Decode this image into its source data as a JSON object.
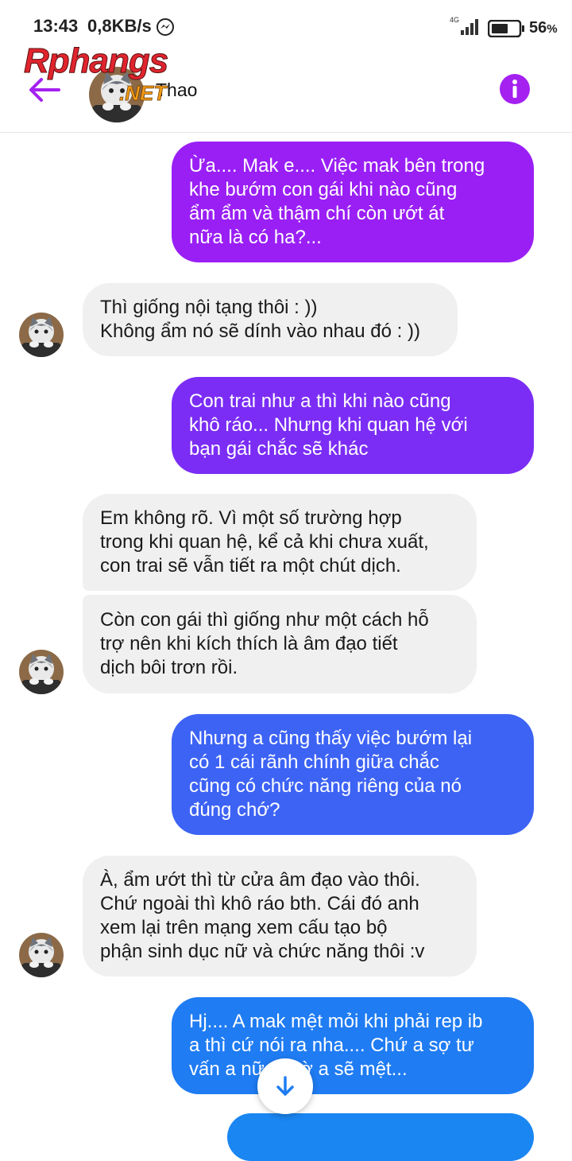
{
  "status_bar": {
    "time": "13:43",
    "speed": "0,8KB/s",
    "network": "4G",
    "battery": "56",
    "battery_unit": "%"
  },
  "header": {
    "contact_name": "Thao",
    "watermark_main": "Rphangs",
    "watermark_sub": ".NET"
  },
  "colors": {
    "accent_purple": "#a421f0",
    "bubble_purple": "#9a1ff5",
    "bubble_violet": "#7b2df5",
    "bubble_blue": "#3d63f5",
    "bubble_lightblue": "#1f7cf3",
    "incoming_bg": "#f0f0f0"
  },
  "messages": [
    {
      "dir": "out",
      "text": "Ừa.... Mak e.... Việc  mak bên trong\nkhe bướm con gái  khi nào  cũng\nẩm ẩm và  thậm chí  còn  ướt át\nnữa  là  có  ha?..."
    },
    {
      "dir": "in",
      "text": "Thì giống nội tạng thôi : ))\nKhông ẩm nó sẽ dính vào nhau đó : ))"
    },
    {
      "dir": "out",
      "text": "Con trai như  a thì  khi nào  cũng\nkhô ráo... Nhưng  khi quan hệ  với\nbạn gái  chắc  sẽ  khác"
    },
    {
      "dir": "in",
      "text": "Em không rõ. Vì một số trường hợp\ntrong khi quan hệ, kể cả khi chưa xuất,\ncon trai sẽ vẫn tiết ra một chút dịch."
    },
    {
      "dir": "in",
      "text": "Còn con gái thì giống như một cách hỗ\ntrợ nên khi kích thích là âm đạo tiết\ndịch bôi trơn rồi."
    },
    {
      "dir": "out",
      "text": "Nhưng  a cũng  thấy  việc  bướm lại\ncó  1 cái  rãnh  chính  giữa  chắc\ncũng  có  chức năng  riêng của  nó\nđúng  chớ?"
    },
    {
      "dir": "in",
      "text": "À, ẩm ướt thì từ cửa âm đạo vào thôi.\nChứ ngoài thì khô ráo bth. Cái đó anh\nxem lại trên mạng xem cấu tạo bộ\nphận sinh dục nữ và chức năng thôi :v"
    },
    {
      "dir": "out",
      "text": "Hj.... A mak mệt mỏi  khi phải rep ib\na thì  cứ  nói  ra nha.... Chứ  a sợ  tư\nvấn  a nữa chờ  a sẽ  mệt..."
    }
  ]
}
